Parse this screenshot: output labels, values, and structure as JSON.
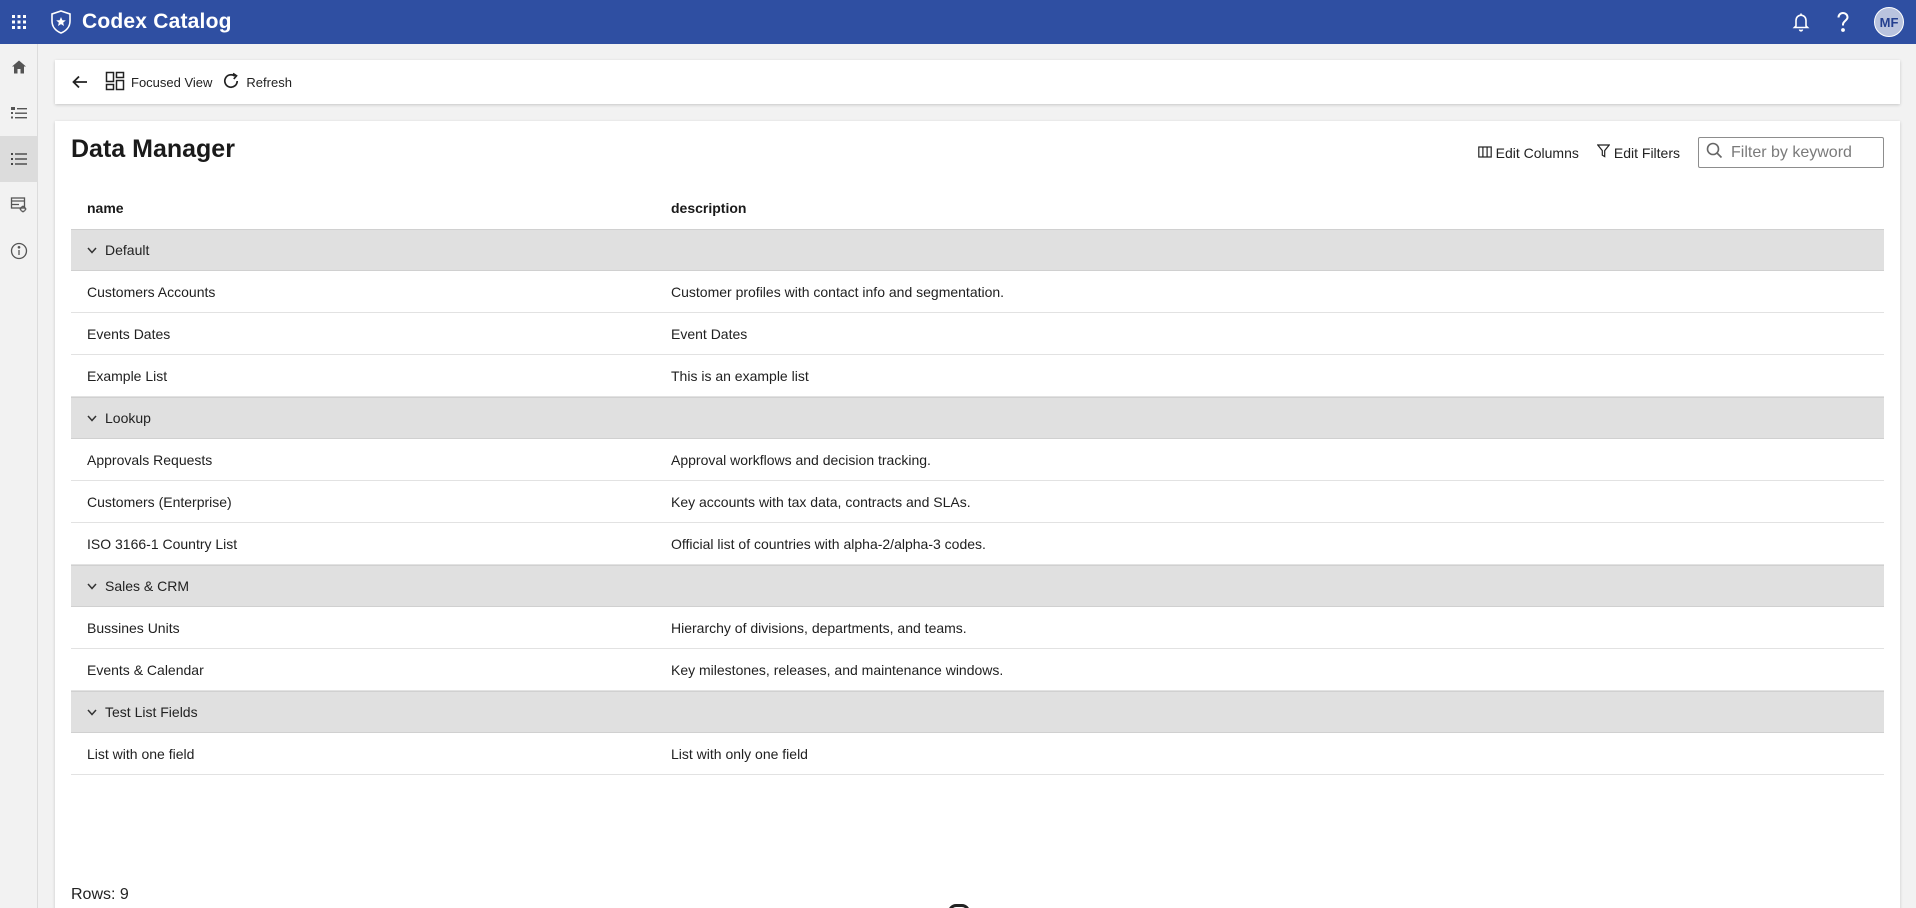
{
  "header": {
    "app_name": "Codex Catalog",
    "user_initials": "MF",
    "accent": "#2f4fa2"
  },
  "toolbar": {
    "focused_view_label": "Focused View",
    "refresh_label": "Refresh"
  },
  "page": {
    "title": "Data Manager",
    "edit_columns_label": "Edit Columns",
    "edit_filters_label": "Edit Filters",
    "search_placeholder": "Filter by keyword"
  },
  "table": {
    "columns": [
      "name",
      "description"
    ],
    "groups": [
      {
        "label": "Default",
        "rows": [
          {
            "name": "Customers Accounts",
            "description": "Customer profiles with contact info and segmentation."
          },
          {
            "name": "Events Dates",
            "description": "Event Dates"
          },
          {
            "name": "Example List",
            "description": "This is an example list"
          }
        ]
      },
      {
        "label": "Lookup",
        "rows": [
          {
            "name": "Approvals Requests",
            "description": "Approval workflows and decision tracking."
          },
          {
            "name": "Customers (Enterprise)",
            "description": "Key accounts with tax data, contracts and SLAs."
          },
          {
            "name": "ISO 3166-1 Country List",
            "description": "Official list of countries with alpha-2/alpha-3 codes."
          }
        ]
      },
      {
        "label": "Sales & CRM",
        "rows": [
          {
            "name": "Bussines Units",
            "description": "Hierarchy of divisions, departments, and teams."
          },
          {
            "name": "Events & Calendar",
            "description": "Key milestones, releases, and maintenance windows."
          }
        ]
      },
      {
        "label": "Test List Fields",
        "rows": [
          {
            "name": "List with one field",
            "description": "List with only one field"
          }
        ]
      }
    ]
  },
  "footer": {
    "rows_count": "Rows: 9"
  },
  "icons": {
    "apps": "apps-grid-icon",
    "logo": "shield-logo-icon",
    "notifications": "bell-icon",
    "help": "help-icon",
    "back": "arrow-left-icon",
    "focused_view": "dashboard-icon",
    "refresh": "refresh-icon",
    "edit_columns": "columns-icon",
    "edit_filters": "filter-icon",
    "search": "search-icon"
  }
}
